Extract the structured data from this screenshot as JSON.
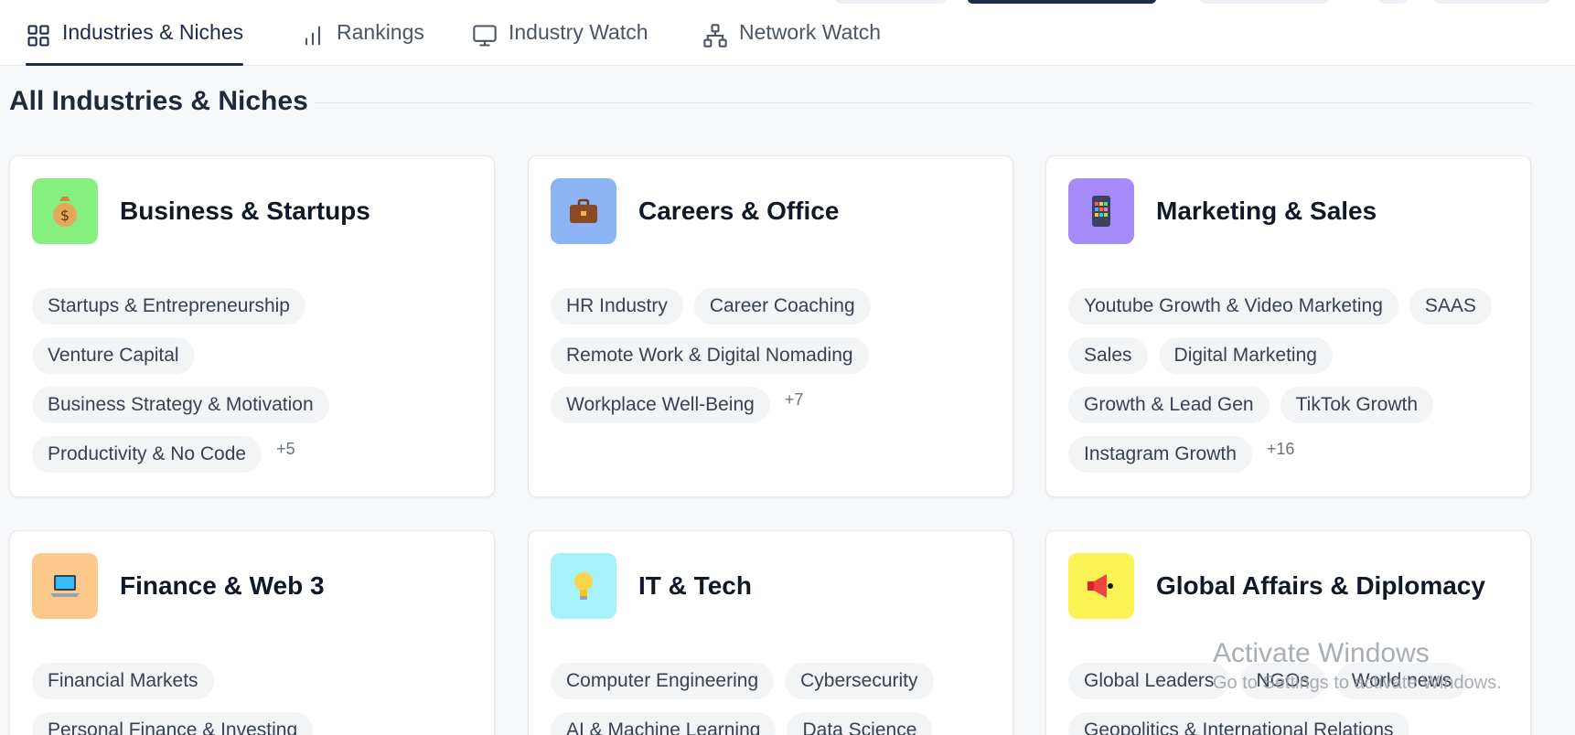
{
  "nav": {
    "tabs": [
      {
        "label": "Industries & Niches",
        "icon": "grid-icon",
        "active": true
      },
      {
        "label": "Rankings",
        "icon": "bar-chart-icon",
        "active": false
      },
      {
        "label": "Industry Watch",
        "icon": "monitor-icon",
        "active": false
      },
      {
        "label": "Network Watch",
        "icon": "network-icon",
        "active": false
      }
    ]
  },
  "section": {
    "title": "All Industries & Niches"
  },
  "cards": [
    {
      "title": "Business & Startups",
      "icon": "money-bag-icon",
      "icon_bg": "#86ef7d",
      "tags": [
        "Startups & Entrepreneurship",
        "Venture Capital",
        "Business Strategy & Motivation",
        "Productivity & No Code"
      ],
      "more": "+5"
    },
    {
      "title": "Careers & Office",
      "icon": "briefcase-icon",
      "icon_bg": "#8db4f5",
      "tags": [
        "HR Industry",
        "Career Coaching",
        "Remote Work & Digital Nomading",
        "Workplace Well-Being"
      ],
      "more": "+7"
    },
    {
      "title": "Marketing & Sales",
      "icon": "mobile-app-icon",
      "icon_bg": "#a48bf7",
      "tags": [
        "Youtube Growth & Video Marketing",
        "SAAS",
        "Sales",
        "Digital Marketing",
        "Growth & Lead Gen",
        "TikTok Growth",
        "Instagram Growth"
      ],
      "more": "+16"
    },
    {
      "title": "Finance & Web 3",
      "icon": "laptop-icon",
      "icon_bg": "#fdc98b",
      "tags": [
        "Financial Markets",
        "Personal Finance & Investing"
      ],
      "more": ""
    },
    {
      "title": "IT & Tech",
      "icon": "lightbulb-icon",
      "icon_bg": "#a5f3f8",
      "tags": [
        "Computer Engineering",
        "Cybersecurity",
        "AI & Machine Learning",
        "Data Science"
      ],
      "more": ""
    },
    {
      "title": "Global Affairs & Diplomacy",
      "icon": "megaphone-icon",
      "icon_bg": "#fbf354",
      "tags": [
        "Global Leaders",
        "NGOs",
        "World news",
        "Geopolitics & International Relations"
      ],
      "more": ""
    }
  ],
  "watermark": {
    "title": "Activate Windows",
    "subtitle": "Go to Settings to activate Windows."
  }
}
